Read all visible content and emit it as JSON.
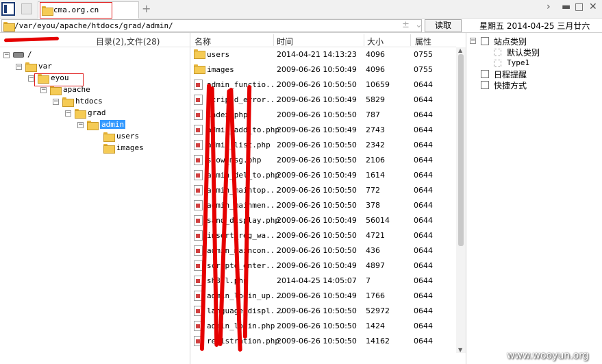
{
  "tab": {
    "title": "cma.org.cn",
    "add_icon": "plus-icon"
  },
  "address": {
    "path": "/var/eyou/apache/htdocs/grad/admin/",
    "read_button": "读取"
  },
  "date": "星期五 2014-04-25 三月廿六",
  "tree": {
    "count_label": "目录(2),文件(28)",
    "nodes": [
      {
        "label": "/",
        "toggle": "−",
        "depth": 0,
        "icon": "drive"
      },
      {
        "label": "var",
        "toggle": "−",
        "depth": 1
      },
      {
        "label": "eyou",
        "toggle": "−",
        "depth": 2
      },
      {
        "label": "apache",
        "toggle": "−",
        "depth": 3
      },
      {
        "label": "htdocs",
        "toggle": "−",
        "depth": 4
      },
      {
        "label": "grad",
        "toggle": "−",
        "depth": 5
      },
      {
        "label": "admin",
        "toggle": "−",
        "depth": 6,
        "selected": true
      },
      {
        "label": "users",
        "toggle": "",
        "depth": 7
      },
      {
        "label": "images",
        "toggle": "",
        "depth": 7
      }
    ]
  },
  "list": {
    "headers": {
      "name": "名称",
      "time": "时间",
      "size": "大小",
      "perm": "属性"
    },
    "rows": [
      {
        "type": "folder",
        "name": "users",
        "time": "2014-04-21 14:13:23",
        "size": "4096",
        "perm": "0755"
      },
      {
        "type": "folder",
        "name": "images",
        "time": "2009-06-26 10:50:49",
        "size": "4096",
        "perm": "0755"
      },
      {
        "type": "file",
        "name": "admin_functio...",
        "time": "2009-06-26 10:50:50",
        "size": "10659",
        "perm": "0644"
      },
      {
        "type": "file",
        "name": "scriptd_error...",
        "time": "2009-06-26 10:50:49",
        "size": "5829",
        "perm": "0644"
      },
      {
        "type": "file",
        "name": "index.php",
        "time": "2009-06-26 10:50:50",
        "size": "787",
        "perm": "0644"
      },
      {
        "type": "file",
        "name": "admin_add_to.php",
        "time": "2009-06-26 10:50:49",
        "size": "2743",
        "perm": "0644"
      },
      {
        "type": "file",
        "name": "admin_list.php",
        "time": "2009-06-26 10:50:50",
        "size": "2342",
        "perm": "0644"
      },
      {
        "type": "file",
        "name": "show_msg.php",
        "time": "2009-06-26 10:50:50",
        "size": "2106",
        "perm": "0644"
      },
      {
        "type": "file",
        "name": "admin_del_to.php",
        "time": "2009-06-26 10:50:49",
        "size": "1614",
        "perm": "0644"
      },
      {
        "type": "file",
        "name": "admin_maintop...",
        "time": "2009-06-26 10:50:50",
        "size": "772",
        "perm": "0644"
      },
      {
        "type": "file",
        "name": "admin_mainmen...",
        "time": "2009-06-26 10:50:50",
        "size": "378",
        "perm": "0644"
      },
      {
        "type": "file",
        "name": "sand_display.php",
        "time": "2009-06-26 10:50:49",
        "size": "56014",
        "perm": "0644"
      },
      {
        "type": "file",
        "name": "insert_reg_wa...",
        "time": "2009-06-26 10:50:50",
        "size": "4721",
        "perm": "0644"
      },
      {
        "type": "file",
        "name": "admin_maincon...",
        "time": "2009-06-26 10:50:50",
        "size": "436",
        "perm": "0644"
      },
      {
        "type": "file",
        "name": "scriptd_enter...",
        "time": "2009-06-26 10:50:49",
        "size": "4897",
        "perm": "0644"
      },
      {
        "type": "file",
        "name": "sh3ll.php",
        "time": "2014-04-25 14:05:07",
        "size": "7",
        "perm": "0644"
      },
      {
        "type": "file",
        "name": "admin_login_up...",
        "time": "2009-06-26 10:50:49",
        "size": "1766",
        "perm": "0644"
      },
      {
        "type": "file",
        "name": "language_displ...",
        "time": "2009-06-26 10:50:50",
        "size": "52972",
        "perm": "0644"
      },
      {
        "type": "file",
        "name": "admin_login.php",
        "time": "2009-06-26 10:50:50",
        "size": "1424",
        "perm": "0644"
      },
      {
        "type": "file",
        "name": "registration.php",
        "time": "2009-06-26 10:50:50",
        "size": "14162",
        "perm": "0644"
      }
    ]
  },
  "right": {
    "category": "站点类别",
    "default_category": "默认类别",
    "type1": "Type1",
    "reminder": "日程提醒",
    "shortcut": "快捷方式"
  },
  "watermark": "www.wooyun.org"
}
